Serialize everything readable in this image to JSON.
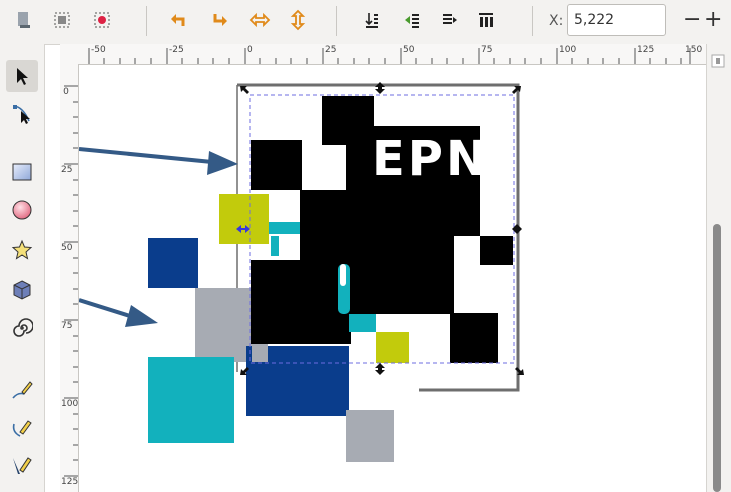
{
  "toolbar": {
    "x_label": "X:",
    "x_value": "5,222",
    "minus": "−",
    "plus": "+",
    "accent_orange": "#e08a1a"
  },
  "rulers": {
    "h_labels": [
      "-50",
      "-25",
      "0",
      "25",
      "50",
      "75",
      "100",
      "125",
      "150"
    ],
    "v_labels": [
      "0",
      "25",
      "50",
      "75",
      "100",
      "125"
    ]
  },
  "canvas": {
    "logo_text": "EPN",
    "colors": {
      "navy": "#0a3d8c",
      "teal": "#12b1bd",
      "lime": "#c2cb0c",
      "gray": "#a7abb3",
      "black": "#000000",
      "arrow": "#345a86"
    }
  }
}
